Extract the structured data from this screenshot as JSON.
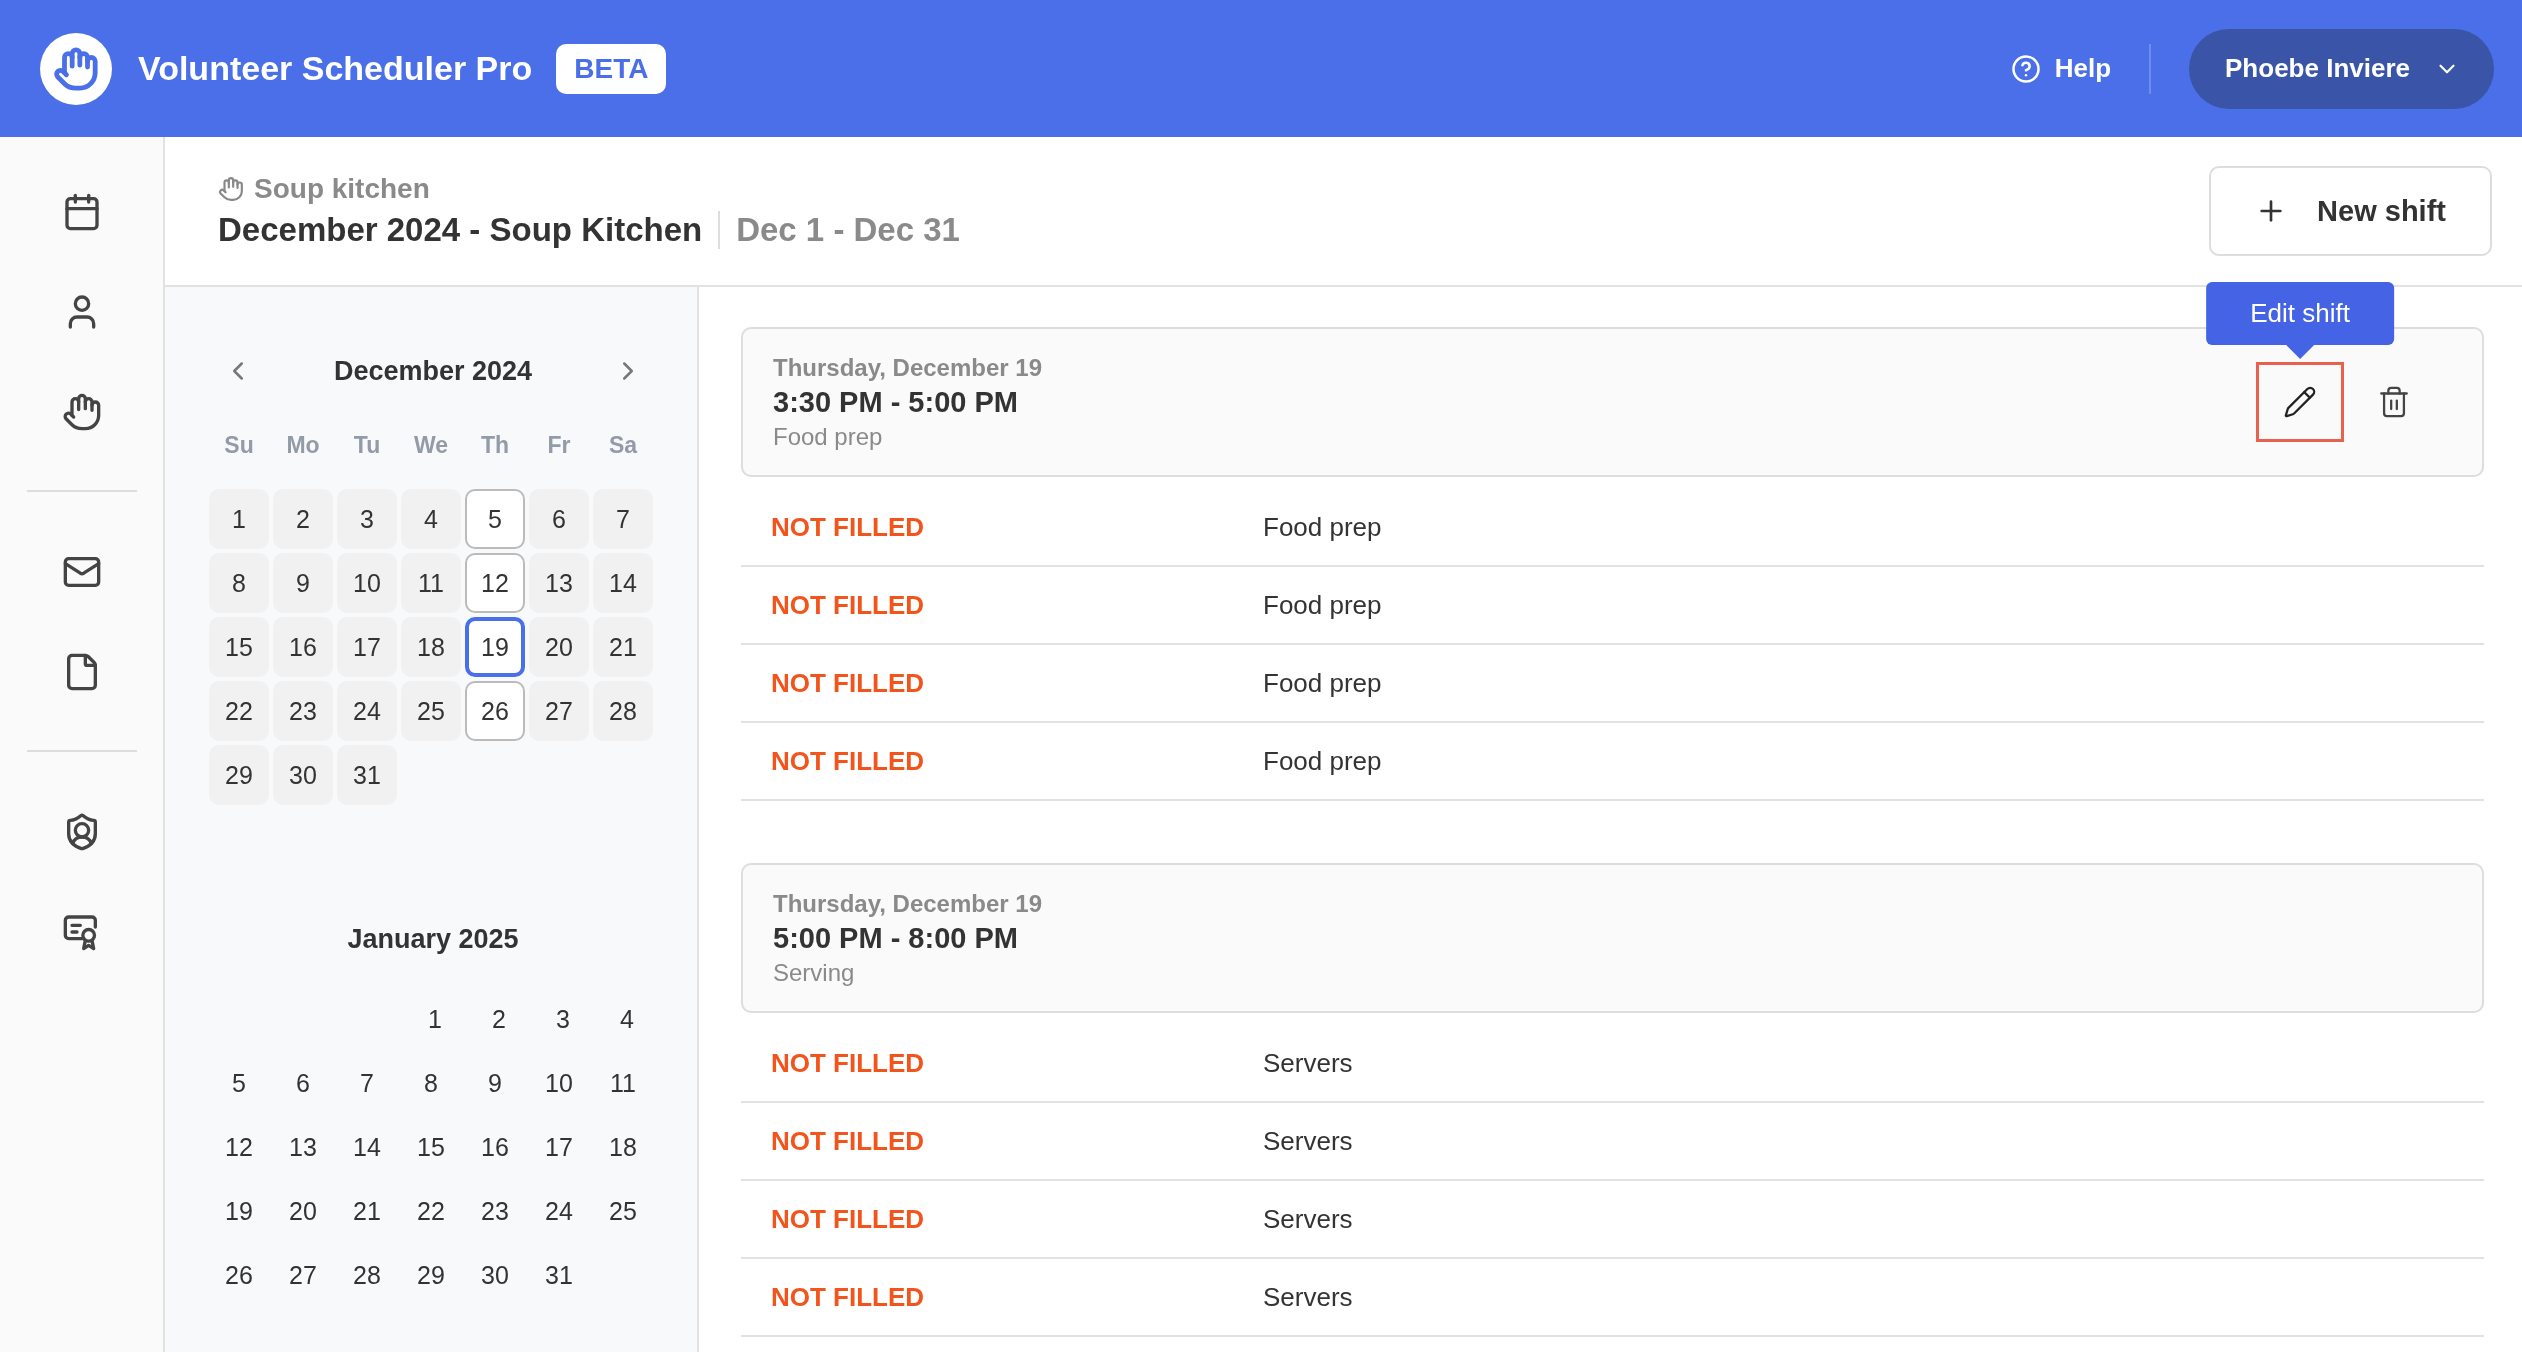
{
  "app": {
    "title": "Volunteer Scheduler Pro",
    "badge": "BETA",
    "help": "Help",
    "user": "Phoebe Inviere"
  },
  "page": {
    "breadcrumb": "Soup kitchen",
    "title": "December 2024 - Soup Kitchen",
    "range": "Dec 1 - Dec 31",
    "new_button": "New shift"
  },
  "weekdays": [
    "Su",
    "Mo",
    "Tu",
    "We",
    "Th",
    "Fr",
    "Sa"
  ],
  "months": [
    {
      "title": "December 2024",
      "weeks": [
        {
          "days": [
            {
              "day": "1",
              "kind": "shaded",
              "selected": false
            },
            {
              "day": "2",
              "kind": "shaded",
              "selected": false
            },
            {
              "day": "3",
              "kind": "shaded",
              "selected": false
            },
            {
              "day": "4",
              "kind": "shaded",
              "selected": false
            },
            {
              "day": "5",
              "kind": "outlined",
              "selected": false
            },
            {
              "day": "6",
              "kind": "shaded",
              "selected": false
            },
            {
              "day": "7",
              "kind": "shaded",
              "selected": false
            }
          ]
        },
        {
          "days": [
            {
              "day": "8",
              "kind": "shaded",
              "selected": false
            },
            {
              "day": "9",
              "kind": "shaded",
              "selected": false
            },
            {
              "day": "10",
              "kind": "shaded",
              "selected": false
            },
            {
              "day": "11",
              "kind": "shaded",
              "selected": false
            },
            {
              "day": "12",
              "kind": "outlined",
              "selected": false
            },
            {
              "day": "13",
              "kind": "shaded",
              "selected": false
            },
            {
              "day": "14",
              "kind": "shaded",
              "selected": false
            }
          ]
        },
        {
          "days": [
            {
              "day": "15",
              "kind": "shaded",
              "selected": false
            },
            {
              "day": "16",
              "kind": "shaded",
              "selected": false
            },
            {
              "day": "17",
              "kind": "shaded",
              "selected": false
            },
            {
              "day": "18",
              "kind": "shaded",
              "selected": false
            },
            {
              "day": "19",
              "kind": "outlined",
              "selected": true
            },
            {
              "day": "20",
              "kind": "shaded",
              "selected": false
            },
            {
              "day": "21",
              "kind": "shaded",
              "selected": false
            }
          ]
        },
        {
          "days": [
            {
              "day": "22",
              "kind": "shaded",
              "selected": false
            },
            {
              "day": "23",
              "kind": "shaded",
              "selected": false
            },
            {
              "day": "24",
              "kind": "shaded",
              "selected": false
            },
            {
              "day": "25",
              "kind": "shaded",
              "selected": false
            },
            {
              "day": "26",
              "kind": "outlined",
              "selected": false
            },
            {
              "day": "27",
              "kind": "shaded",
              "selected": false
            },
            {
              "day": "28",
              "kind": "shaded",
              "selected": false
            }
          ]
        },
        {
          "days": [
            {
              "day": "29",
              "kind": "shaded",
              "selected": false
            },
            {
              "day": "30",
              "kind": "shaded",
              "selected": false
            },
            {
              "day": "31",
              "kind": "shaded",
              "selected": false
            }
          ]
        }
      ]
    },
    {
      "title": "January 2025",
      "weeks": [
        {
          "days": [
            {
              "day": "1",
              "kind": "plain",
              "selected": false
            },
            {
              "day": "2",
              "kind": "plain",
              "selected": false
            },
            {
              "day": "3",
              "kind": "plain",
              "selected": false
            },
            {
              "day": "4",
              "kind": "plain",
              "selected": false
            }
          ]
        },
        {
          "days": [
            {
              "day": "5",
              "kind": "plain",
              "selected": false
            },
            {
              "day": "6",
              "kind": "plain",
              "selected": false
            },
            {
              "day": "7",
              "kind": "plain",
              "selected": false
            },
            {
              "day": "8",
              "kind": "plain",
              "selected": false
            },
            {
              "day": "9",
              "kind": "plain",
              "selected": false
            },
            {
              "day": "10",
              "kind": "plain",
              "selected": false
            },
            {
              "day": "11",
              "kind": "plain",
              "selected": false
            }
          ]
        },
        {
          "days": [
            {
              "day": "12",
              "kind": "plain",
              "selected": false
            },
            {
              "day": "13",
              "kind": "plain",
              "selected": false
            },
            {
              "day": "14",
              "kind": "plain",
              "selected": false
            },
            {
              "day": "15",
              "kind": "plain",
              "selected": false
            },
            {
              "day": "16",
              "kind": "plain",
              "selected": false
            },
            {
              "day": "17",
              "kind": "plain",
              "selected": false
            },
            {
              "day": "18",
              "kind": "plain",
              "selected": false
            }
          ]
        },
        {
          "days": [
            {
              "day": "19",
              "kind": "plain",
              "selected": false
            },
            {
              "day": "20",
              "kind": "plain",
              "selected": false
            },
            {
              "day": "21",
              "kind": "plain",
              "selected": false
            },
            {
              "day": "22",
              "kind": "plain",
              "selected": false
            },
            {
              "day": "23",
              "kind": "plain",
              "selected": false
            },
            {
              "day": "24",
              "kind": "plain",
              "selected": false
            },
            {
              "day": "25",
              "kind": "plain",
              "selected": false
            }
          ]
        },
        {
          "days": [
            {
              "day": "26",
              "kind": "plain",
              "selected": false
            },
            {
              "day": "27",
              "kind": "plain",
              "selected": false
            },
            {
              "day": "28",
              "kind": "plain",
              "selected": false
            },
            {
              "day": "29",
              "kind": "plain",
              "selected": false
            },
            {
              "day": "30",
              "kind": "plain",
              "selected": false
            },
            {
              "day": "31",
              "kind": "plain",
              "selected": false
            }
          ]
        }
      ]
    }
  ],
  "shifts": [
    {
      "date": "Thursday, December 19",
      "time": "3:30 PM - 5:00 PM",
      "task": "Food prep",
      "tooltip": "Edit shift",
      "slots": [
        {
          "status": "NOT FILLED",
          "role": "Food prep"
        },
        {
          "status": "NOT FILLED",
          "role": "Food prep"
        },
        {
          "status": "NOT FILLED",
          "role": "Food prep"
        },
        {
          "status": "NOT FILLED",
          "role": "Food prep"
        }
      ]
    },
    {
      "date": "Thursday, December 19",
      "time": "5:00 PM - 8:00 PM",
      "task": "Serving",
      "slots": [
        {
          "status": "NOT FILLED",
          "role": "Servers"
        },
        {
          "status": "NOT FILLED",
          "role": "Servers"
        },
        {
          "status": "NOT FILLED",
          "role": "Servers"
        },
        {
          "status": "NOT FILLED",
          "role": "Servers"
        }
      ]
    }
  ]
}
